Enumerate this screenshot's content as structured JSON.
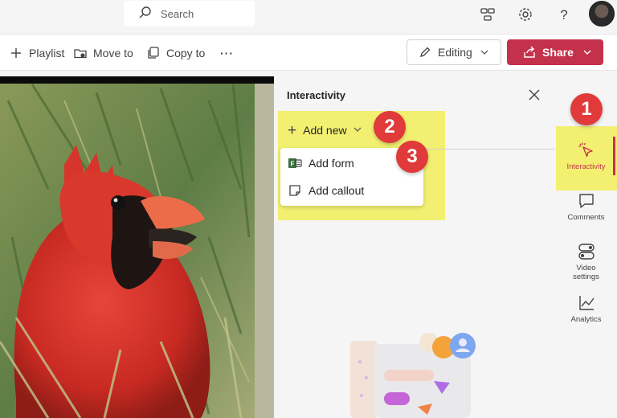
{
  "topbar": {
    "search_placeholder": "Search",
    "icons": [
      "search-icon",
      "share-network-icon",
      "gear-icon",
      "help-icon",
      "avatar"
    ]
  },
  "commandbar": {
    "playlist_label": "Playlist",
    "move_label": "Move to",
    "copy_label": "Copy to",
    "more_label": "···",
    "editing_label": "Editing",
    "share_label": "Share"
  },
  "panel": {
    "title": "Interactivity",
    "add_new_label": "Add new",
    "menu": [
      {
        "label": "Add form",
        "icon": "form-icon"
      },
      {
        "label": "Add callout",
        "icon": "callout-icon"
      }
    ]
  },
  "rail": {
    "items": [
      {
        "label": "Interactivity",
        "icon": "interactivity-icon",
        "active": true
      },
      {
        "label": "Comments",
        "icon": "comment-icon"
      },
      {
        "label": "Video settings",
        "icon": "settings-toggle-icon"
      },
      {
        "label": "Analytics",
        "icon": "analytics-icon"
      }
    ]
  },
  "badges": [
    "1",
    "2",
    "3"
  ],
  "colors": {
    "accent": "#c4314b",
    "highlight": "#f2ef5e",
    "badge": "#e03a3a"
  }
}
